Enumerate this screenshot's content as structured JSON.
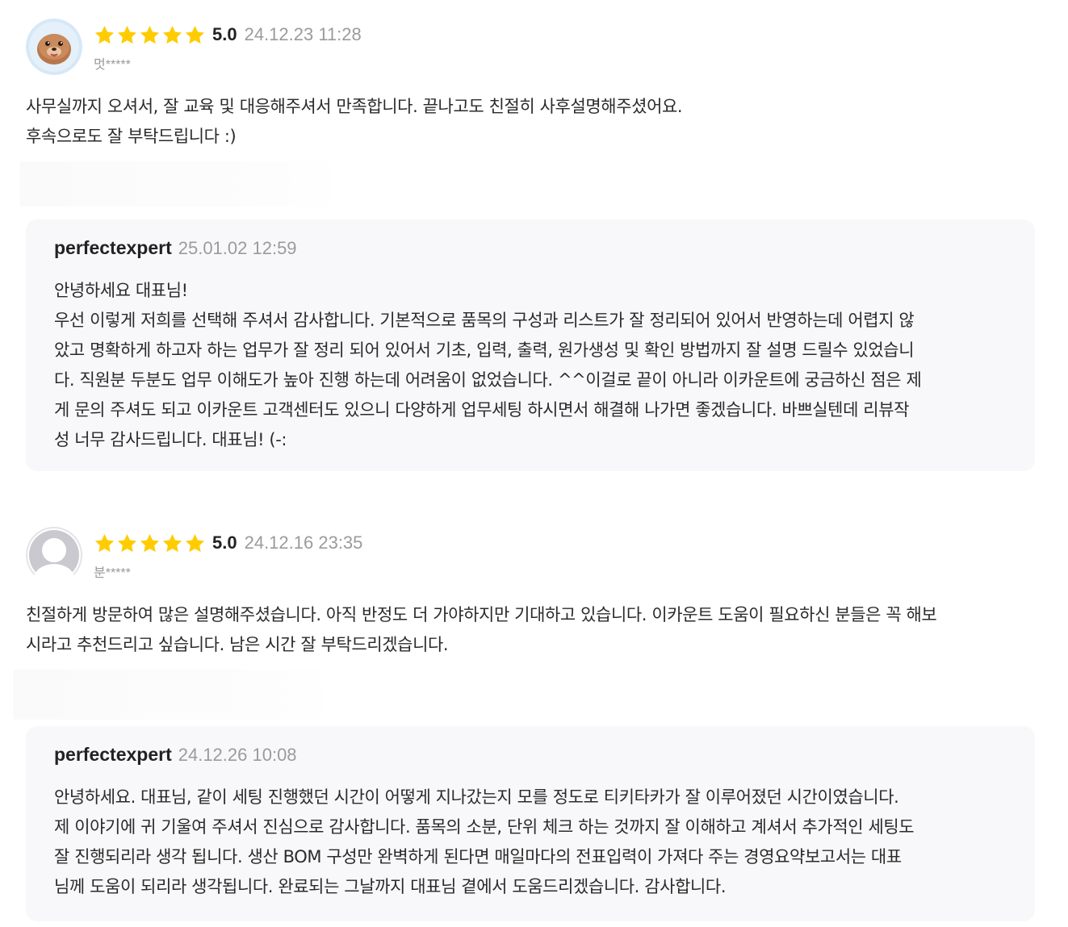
{
  "colors": {
    "star": "#ffcc00",
    "meta_gray": "#9b9b9b",
    "reply_bg": "#f8f8fa"
  },
  "reviews": [
    {
      "avatar_icon": "seal-avatar-icon",
      "rating": 5,
      "score": "5.0",
      "date": "24.12.23 11:28",
      "username": "멋*****",
      "text_lines": [
        "사무실까지 오셔서, 잘 교육 및 대응해주셔서 만족합니다. 끝나고도 친절히 사후설명해주셨어요.",
        "후속으로도 잘 부탁드립니다 :)"
      ],
      "reply": {
        "author": "perfectexpert",
        "date": "25.01.02 12:59",
        "text_lines": [
          "안녕하세요 대표님!",
          "우선 이렇게 저희를 선택해 주셔서 감사합니다. 기본적으로 품목의 구성과 리스트가 잘 정리되어 있어서 반영하는데 어렵지 않",
          "았고 명확하게 하고자 하는 업무가 잘 정리 되어 있어서 기초, 입력, 출력, 원가생성 및 확인 방법까지 잘 설명 드릴수 있었습니",
          "다. 직원분 두분도 업무 이해도가 높아 진행 하는데 어려움이 없었습니다. ^^이걸로 끝이 아니라 이카운트에 궁금하신 점은 제",
          "게 문의 주셔도 되고 이카운트 고객센터도 있으니 다양하게 업무세팅 하시면서 해결해 나가면 좋겠습니다. 바쁘실텐데 리뷰작",
          "성 너무 감사드립니다. 대표님! (-:"
        ]
      }
    },
    {
      "avatar_icon": "default-user-avatar-icon",
      "rating": 5,
      "score": "5.0",
      "date": "24.12.16 23:35",
      "username": "분*****",
      "text_lines": [
        "친절하게 방문하여 많은 설명해주셨습니다. 아직 반정도 더 가야하지만 기대하고 있습니다. 이카운트 도움이 필요하신 분들은 꼭 해보",
        "시라고 추천드리고 싶습니다. 남은 시간 잘 부탁드리겠습니다."
      ],
      "reply": {
        "author": "perfectexpert",
        "date": "24.12.26 10:08",
        "text_lines": [
          "안녕하세요. 대표님, 같이 세팅 진행했던 시간이 어떻게 지나갔는지 모를 정도로 티키타카가 잘 이루어졌던 시간이였습니다.",
          "제 이야기에 귀 기울여 주셔서 진심으로 감사합니다. 품목의 소분, 단위 체크 하는 것까지 잘 이해하고 계셔서 추가적인 세팅도",
          "잘 진행되리라 생각 됩니다. 생산 BOM 구성만 완벽하게 된다면 매일마다의 전표입력이 가져다 주는 경영요약보고서는 대표",
          "님께 도움이 되리라 생각됩니다. 완료되는 그날까지 대표님 곁에서 도움드리겠습니다. 감사합니다."
        ]
      }
    }
  ]
}
